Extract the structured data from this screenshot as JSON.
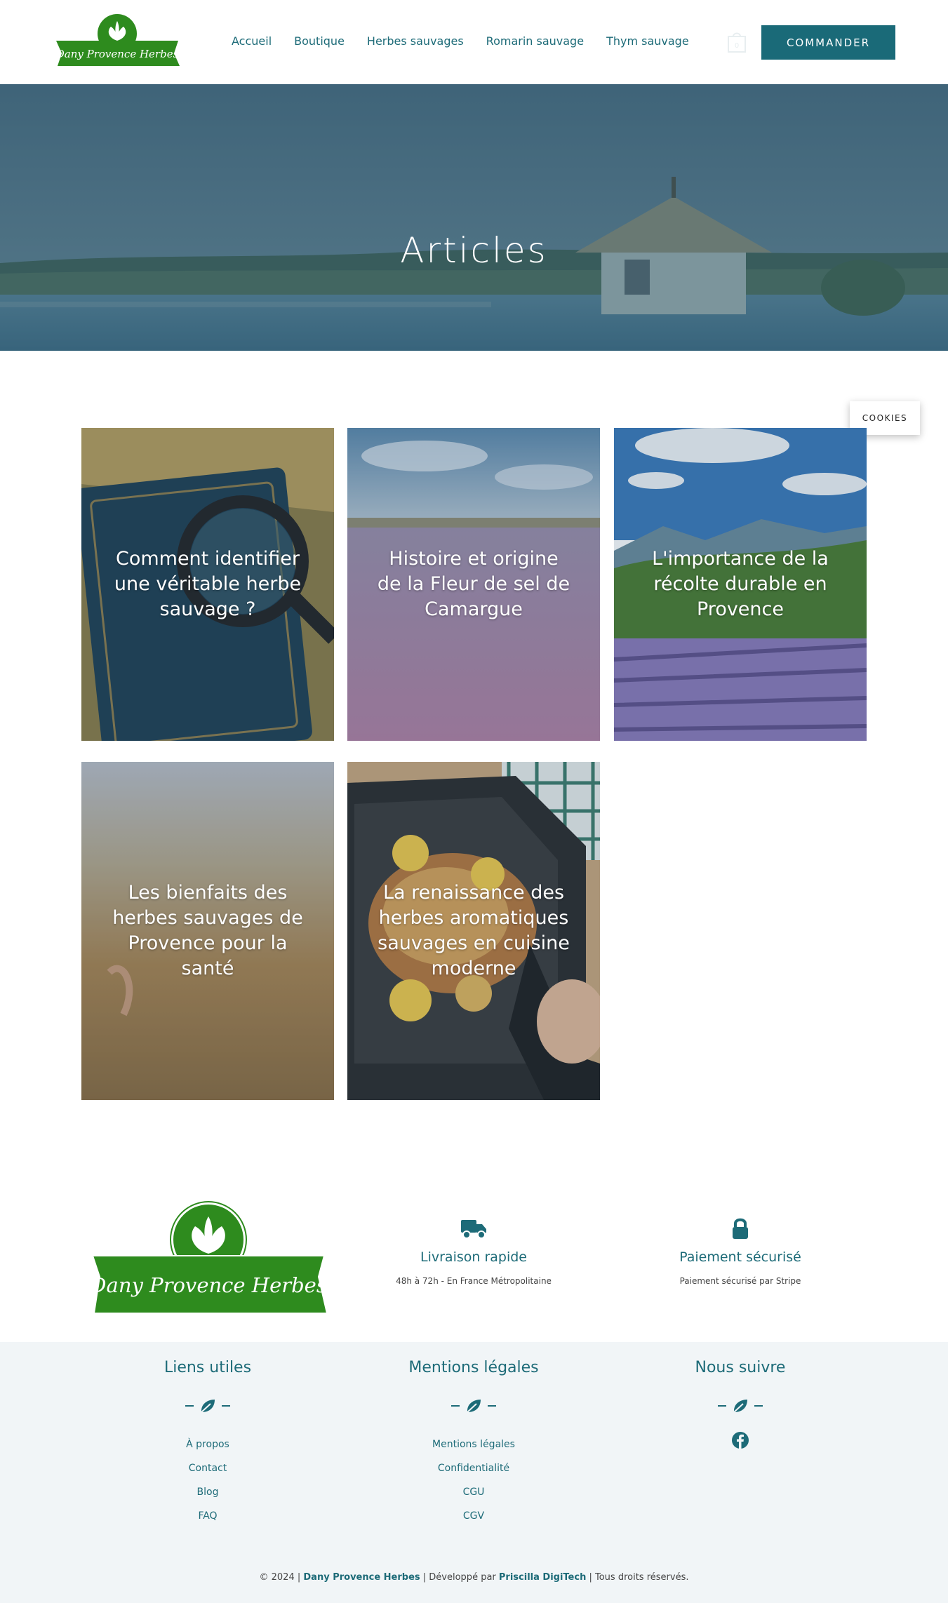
{
  "header": {
    "logo_text": "Dany Provence Herbes",
    "nav": [
      "Accueil",
      "Boutique",
      "Herbes sauvages",
      "Romarin sauvage",
      "Thym sauvage"
    ],
    "cart_count": "0",
    "cta_label": "COMMANDER"
  },
  "hero": {
    "title": "Articles"
  },
  "cookies": {
    "label": "COOKIES"
  },
  "articles": [
    {
      "title": "Comment identifier une véritable herbe sauvage ?"
    },
    {
      "title": "Histoire et origine de la Fleur de sel de Camargue"
    },
    {
      "title": "L'importance de la récolte durable en Provence"
    },
    {
      "title": "Les bienfaits des herbes sauvages de Provence pour la santé"
    },
    {
      "title": "La renaissance des herbes aromatiques sauvages en cuisine moderne"
    }
  ],
  "features": [
    {
      "icon": "truck-icon",
      "title": "Livraison rapide",
      "desc": "48h à 72h - En France Métropolitaine"
    },
    {
      "icon": "lock-icon",
      "title": "Paiement sécurisé",
      "desc": "Paiement sécurisé par Stripe"
    }
  ],
  "footer": {
    "cols": [
      {
        "title": "Liens utiles",
        "links": [
          "À propos",
          "Contact",
          "Blog",
          "FAQ"
        ]
      },
      {
        "title": "Mentions légales",
        "links": [
          "Mentions légales",
          "Confidentialité",
          "CGU",
          "CGV"
        ]
      },
      {
        "title": "Nous suivre",
        "social": "facebook-icon"
      }
    ],
    "copyright_prefix": "© 2024 |",
    "brand": "Dany Provence Herbes",
    "dev_prefix": "| Développé par",
    "developer": "Priscilla DigiTech",
    "rights": "| Tous droits réservés."
  },
  "colors": {
    "accent": "#1a6a78",
    "logo_green": "#2e8b1e",
    "footer_bg": "#f1f5f7"
  }
}
